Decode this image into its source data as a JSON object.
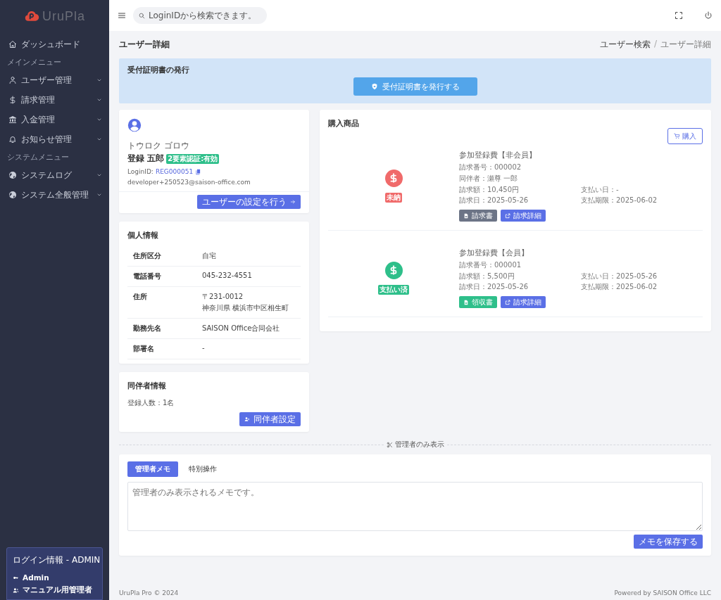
{
  "logo": {
    "text": "UruPla"
  },
  "sidebar": {
    "items": [
      {
        "kind": "link",
        "label": "ダッシュボード",
        "expandable": false
      },
      {
        "kind": "section",
        "label": "メインメニュー"
      },
      {
        "kind": "link",
        "label": "ユーザー管理",
        "expandable": true
      },
      {
        "kind": "link",
        "label": "請求管理",
        "expandable": true
      },
      {
        "kind": "link",
        "label": "入金管理",
        "expandable": true
      },
      {
        "kind": "link",
        "label": "お知らせ管理",
        "expandable": true
      },
      {
        "kind": "section",
        "label": "システムメニュー"
      },
      {
        "kind": "link",
        "label": "システムログ",
        "expandable": true
      },
      {
        "kind": "link",
        "label": "システム全般管理",
        "expandable": true
      }
    ],
    "login_info": {
      "title": "ログイン情報 - ADMIN",
      "role": "Admin",
      "user": "マニュアル用管理者"
    }
  },
  "topbar": {
    "search": {
      "placeholder": "LoginIDから検索できます。"
    }
  },
  "page": {
    "title": "ユーザー詳細",
    "breadcrumb": [
      "ユーザー検索",
      "ユーザー詳細"
    ],
    "breadcrumb_separator": "/"
  },
  "receipt_banner": {
    "title": "受付証明書の発行",
    "button": "受付証明書を発行する"
  },
  "user": {
    "kana": "トウロク ゴロウ",
    "name": "登録 五郎",
    "badge": "2要素認証:有効",
    "login_label": "LoginID:",
    "login_id": "REG000051",
    "email": "developer+250523@saison-office.com",
    "settings_button": "ユーザーの設定を行う"
  },
  "personal": {
    "title": "個人情報",
    "rows": [
      {
        "label": "住所区分",
        "value": [
          "自宅"
        ]
      },
      {
        "label": "電話番号",
        "value": [
          "045-232-4551"
        ]
      },
      {
        "label": "住所",
        "value": [
          "〒231-0012",
          "神奈川県 横浜市中区相生町"
        ]
      },
      {
        "label": "勤務先名",
        "value": [
          "SAISON Office合同会社"
        ]
      },
      {
        "label": "部署名",
        "value": [
          "-"
        ]
      }
    ]
  },
  "companions": {
    "title": "同伴者情報",
    "count": "登録人数：1名",
    "button": "同伴者設定"
  },
  "purchases": {
    "title": "購入商品",
    "buy_button": "購入",
    "items": [
      {
        "status": "未納",
        "color": "#f06a6a",
        "title": "参加登録費【非会員】",
        "invoice_no": "請求番号：000002",
        "companion": "同伴者：瀬尊 一郎",
        "amount": "請求額：10,450円",
        "paid_date": "支払い日：-",
        "invoice_date": "請求日：2025-05-26",
        "due_date": "支払期限：2025-06-02",
        "buttons": [
          {
            "kind": "invoice",
            "label": "請求書"
          },
          {
            "kind": "detail",
            "label": "請求詳細"
          }
        ]
      },
      {
        "status": "支払い済",
        "color": "#2ebf8a",
        "title": "参加登録費【会員】",
        "invoice_no": "請求番号：000001",
        "amount": "請求額：5,500円",
        "paid_date": "支払い日：2025-05-26",
        "invoice_date": "請求日：2025-05-26",
        "due_date": "支払期限：2025-06-02",
        "buttons": [
          {
            "kind": "receipt",
            "label": "領収書"
          },
          {
            "kind": "detail",
            "label": "請求詳細"
          }
        ]
      }
    ]
  },
  "admin_divider": "管理者のみ表示",
  "admin": {
    "tabs": [
      {
        "label": "管理者メモ",
        "selected": true
      },
      {
        "label": "特別操作",
        "selected": false
      }
    ],
    "memo": {
      "placeholder": "管理者のみ表示されるメモです。"
    },
    "save_button": "メモを保存する"
  },
  "footer": {
    "left": "UruPla Pro © 2024",
    "right": "Powered by SAISON Office LLC"
  }
}
